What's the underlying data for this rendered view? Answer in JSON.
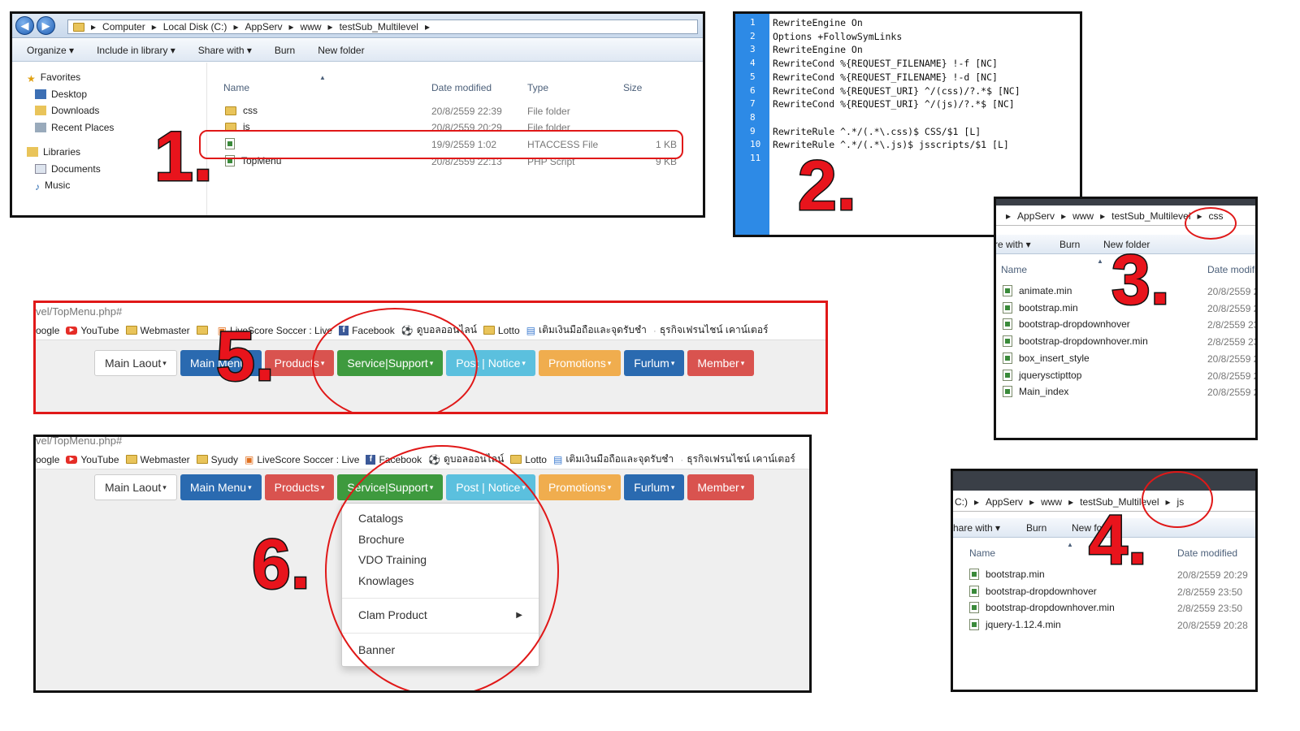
{
  "explorer1": {
    "breadcrumb": [
      "Computer",
      "Local Disk (C:)",
      "AppServ",
      "www",
      "testSub_Multilevel"
    ],
    "commands": [
      "Organize",
      "Include in library",
      "Share with",
      "Burn",
      "New folder"
    ],
    "nav": {
      "favorites": "Favorites",
      "items": [
        "Desktop",
        "Downloads",
        "Recent Places"
      ],
      "libraries": "Libraries",
      "lib_items": [
        "Documents",
        "Music"
      ]
    },
    "columns": [
      "Name",
      "Date modified",
      "Type",
      "Size"
    ],
    "files": [
      {
        "name": "css",
        "date": "20/8/2559 22:39",
        "type": "File folder",
        "size": ""
      },
      {
        "name": "js",
        "date": "20/8/2559 20:29",
        "type": "File folder",
        "size": ""
      },
      {
        "name": "",
        "date": "19/9/2559 1:02",
        "type": "HTACCESS File",
        "size": "1 KB"
      },
      {
        "name": "TopMenu",
        "date": "20/8/2559 22:13",
        "type": "PHP Script",
        "size": "9 KB"
      }
    ]
  },
  "code": {
    "lines": [
      "1",
      "2",
      "3",
      "4",
      "5",
      "6",
      "7",
      "8",
      "9",
      "10",
      "11"
    ],
    "text": "RewriteEngine On\nOptions +FollowSymLinks\nRewriteEngine On\nRewriteCond %{REQUEST_FILENAME} !-f [NC]\nRewriteCond %{REQUEST_FILENAME} !-d [NC]\nRewriteCond %{REQUEST_URI} ^/(css)/?.*$ [NC]\nRewriteCond %{REQUEST_URI} ^/(js)/?.*$ [NC]\n\nRewriteRule ^.*/(.*\\.css)$ CSS/$1 [L]\nRewriteRule ^.*/(.*\\.js)$ jsscripts/$1 [L]\n"
  },
  "explorer3": {
    "breadcrumb": [
      "AppServ",
      "www",
      "testSub_Multilevel",
      "css"
    ],
    "commands": [
      "re with",
      "Burn",
      "New folder"
    ],
    "columns": [
      "Name",
      "Date modifi"
    ],
    "files": [
      {
        "name": "animate.min",
        "date": "20/8/2559 2"
      },
      {
        "name": "bootstrap.min",
        "date": "20/8/2559 2"
      },
      {
        "name": "bootstrap-dropdownhover",
        "date": "2/8/2559 23"
      },
      {
        "name": "bootstrap-dropdownhover.min",
        "date": "2/8/2559 23"
      },
      {
        "name": "box_insert_style",
        "date": "20/8/2559 2"
      },
      {
        "name": "jquerysctipttop",
        "date": "20/8/2559 2"
      },
      {
        "name": "Main_index",
        "date": "20/8/2559 2"
      }
    ]
  },
  "explorer4": {
    "breadcrumb": [
      "C:)",
      "AppServ",
      "www",
      "testSub_Multilevel",
      "js"
    ],
    "commands": [
      "hare with",
      "Burn",
      "New fold"
    ],
    "columns": [
      "Name",
      "Date modified"
    ],
    "files": [
      {
        "name": "bootstrap.min",
        "date": "20/8/2559 20:29"
      },
      {
        "name": "bootstrap-dropdownhover",
        "date": "2/8/2559 23:50"
      },
      {
        "name": "bootstrap-dropdownhover.min",
        "date": "2/8/2559 23:50"
      },
      {
        "name": "jquery-1.12.4.min",
        "date": "20/8/2559 20:28"
      }
    ]
  },
  "browser5": {
    "url": "vel/TopMenu.php#",
    "bookmarks": [
      "oogle",
      "YouTube",
      "Webmaster",
      "",
      "LiveScore Soccer : Live",
      "Facebook",
      "ดูบอลออนไลน์",
      "Lotto",
      "เติมเงินมือถือและจุดรับชำ",
      "ธุรกิจเฟรนไชน์ เคาน์เตอร์"
    ],
    "menu": [
      "Main Laout",
      "Main Menu",
      "Products",
      "Service|Support",
      "Post | Notice",
      "Promotions",
      "Furlum",
      "Member"
    ]
  },
  "browser6": {
    "url": "vel/TopMenu.php#",
    "bookmarks": [
      "oogle",
      "YouTube",
      "Webmaster",
      "Syudy",
      "LiveScore Soccer : Live",
      "Facebook",
      "ดูบอลออนไลน์",
      "Lotto",
      "เติมเงินมือถือและจุดรับชำ",
      "ธุรกิจเฟรนไชน์ เคาน์เตอร์"
    ],
    "menu": [
      "Main Laout",
      "Main Menu",
      "Products",
      "Service|Support",
      "Post | Notice",
      "Promotions",
      "Furlum",
      "Member"
    ],
    "dropdown": [
      "Catalogs",
      "Brochure",
      "VDO Training",
      "Knowlages",
      "Clam Product",
      "Banner"
    ]
  },
  "steps": [
    "1.",
    "2.",
    "3.",
    "4.",
    "5.",
    "6."
  ],
  "colors": {
    "default": "#ffffff",
    "primary": "#2a6ab0",
    "danger": "#d9534f",
    "success": "#3e9a3e",
    "info": "#5bc0de",
    "warning": "#f0ad4e",
    "annotation": "#e01818"
  }
}
